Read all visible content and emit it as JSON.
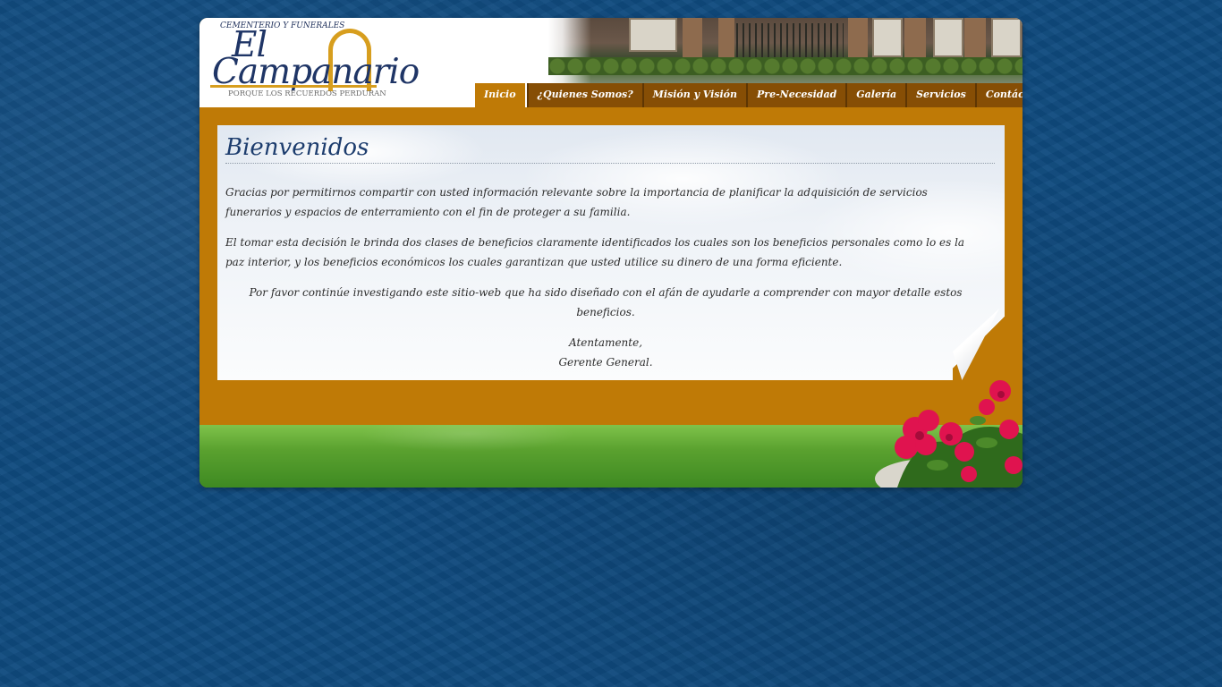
{
  "brand": {
    "top_line": "CEMENTERIO Y FUNERALES",
    "name_line1": "El",
    "name_line2": "Campanario",
    "tagline": "PORQUE LOS RECUERDOS PERDURAN"
  },
  "nav": {
    "items": [
      {
        "label": "Inicio",
        "active": true
      },
      {
        "label": "¿Quienes Somos?",
        "active": false
      },
      {
        "label": "Misión y Visión",
        "active": false
      },
      {
        "label": "Pre-Necesidad",
        "active": false
      },
      {
        "label": "Galería",
        "active": false
      },
      {
        "label": "Servicios",
        "active": false
      },
      {
        "label": "Contáctenos",
        "active": false
      }
    ]
  },
  "content": {
    "title": "Bienvenidos",
    "paragraph1": "Gracias por permitirnos compartir con usted información relevante sobre la importancia de planificar la adquisición de servicios funerarios y espacios de enterramiento con el fin de proteger a su familia.",
    "paragraph2": "El tomar esta decisión le brinda dos clases de beneficios claramente identificados los cuales son los beneficios personales como lo es la paz interior, y los beneficios económicos los cuales garantizan que usted utilice su dinero de una forma eficiente.",
    "paragraph3": "Por favor continúe investigando este sitio-web que ha sido diseñado con el afán de ayudarle a comprender con mayor detalle estos beneficios.",
    "closing": "Atentamente,",
    "signature": "Gerente General."
  },
  "colors": {
    "background_blue": "#0f4a7e",
    "accent_gold": "#bf7a06",
    "nav_brown": "#864e05",
    "title_blue": "#1d3d6e"
  }
}
